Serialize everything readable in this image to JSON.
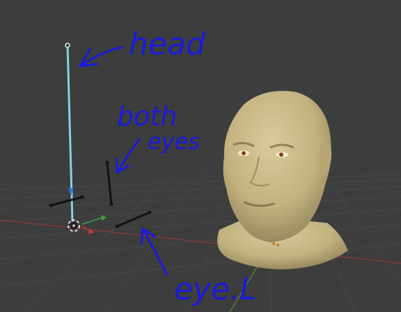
{
  "annotations": {
    "head_label": "head",
    "both_eyes_line1": "both",
    "both_eyes_line2": "eyes",
    "eye_l_label": "eye.L"
  },
  "colors": {
    "background": "#3d3d3d",
    "grid": "#4a4a4a",
    "x_axis": "#8a3a3a",
    "y_axis": "#4f7d3a",
    "annotation_ink": "#1a1ad9",
    "selected_bone": "#7fd6e6",
    "bone": "#111111",
    "skin": "#c8b88a"
  },
  "icons": {
    "object_origin": "3d-cursor-icon",
    "gizmo": "transform-gizmo-icon"
  }
}
